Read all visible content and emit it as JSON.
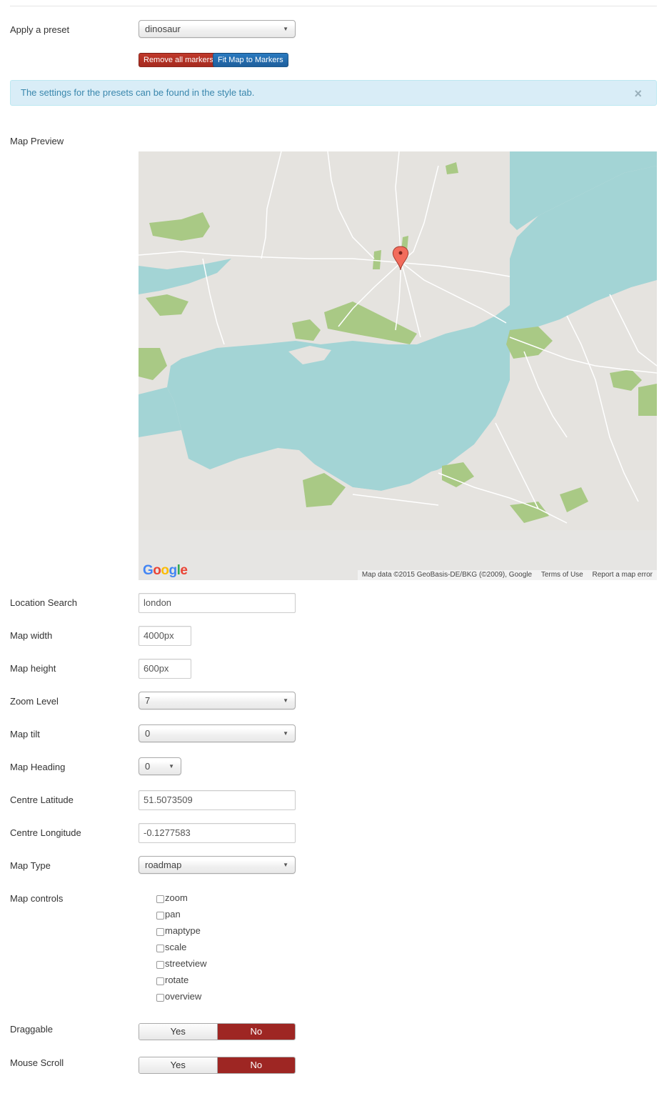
{
  "preset": {
    "label": "Apply a preset",
    "value": "dinosaur"
  },
  "buttons": {
    "remove_markers": "Remove all markers",
    "fit_map": "Fit Map to Markers"
  },
  "alert": {
    "text": "The settings for the presets can be found in the style tab.",
    "close": "×"
  },
  "map_preview": {
    "label": "Map Preview",
    "attribution": "Map data ©2015 GeoBasis-DE/BKG (©2009), Google",
    "terms": "Terms of Use",
    "report": "Report a map error",
    "logo": [
      "G",
      "o",
      "o",
      "g",
      "l",
      "e"
    ],
    "colors": {
      "land": "#e5e3df",
      "water": "#a3d4d5",
      "park": "#a9c985",
      "road": "#ffffff",
      "marker": "#f26c5c"
    }
  },
  "fields": {
    "location_search": {
      "label": "Location Search",
      "value": "london"
    },
    "map_width": {
      "label": "Map width",
      "value": "4000px"
    },
    "map_height": {
      "label": "Map height",
      "value": "600px"
    },
    "zoom_level": {
      "label": "Zoom Level",
      "value": "7"
    },
    "map_tilt": {
      "label": "Map tilt",
      "value": "0"
    },
    "map_heading": {
      "label": "Map Heading",
      "value": "0"
    },
    "centre_latitude": {
      "label": "Centre Latitude",
      "value": "51.5073509"
    },
    "centre_longitude": {
      "label": "Centre Longitude",
      "value": "-0.1277583"
    },
    "map_type": {
      "label": "Map Type",
      "value": "roadmap"
    }
  },
  "map_controls": {
    "label": "Map controls",
    "items": [
      "zoom",
      "pan",
      "maptype",
      "scale",
      "streetview",
      "rotate",
      "overview"
    ]
  },
  "draggable": {
    "label": "Draggable",
    "yes": "Yes",
    "no": "No"
  },
  "mouse_scroll": {
    "label": "Mouse Scroll",
    "yes": "Yes",
    "no": "No"
  }
}
